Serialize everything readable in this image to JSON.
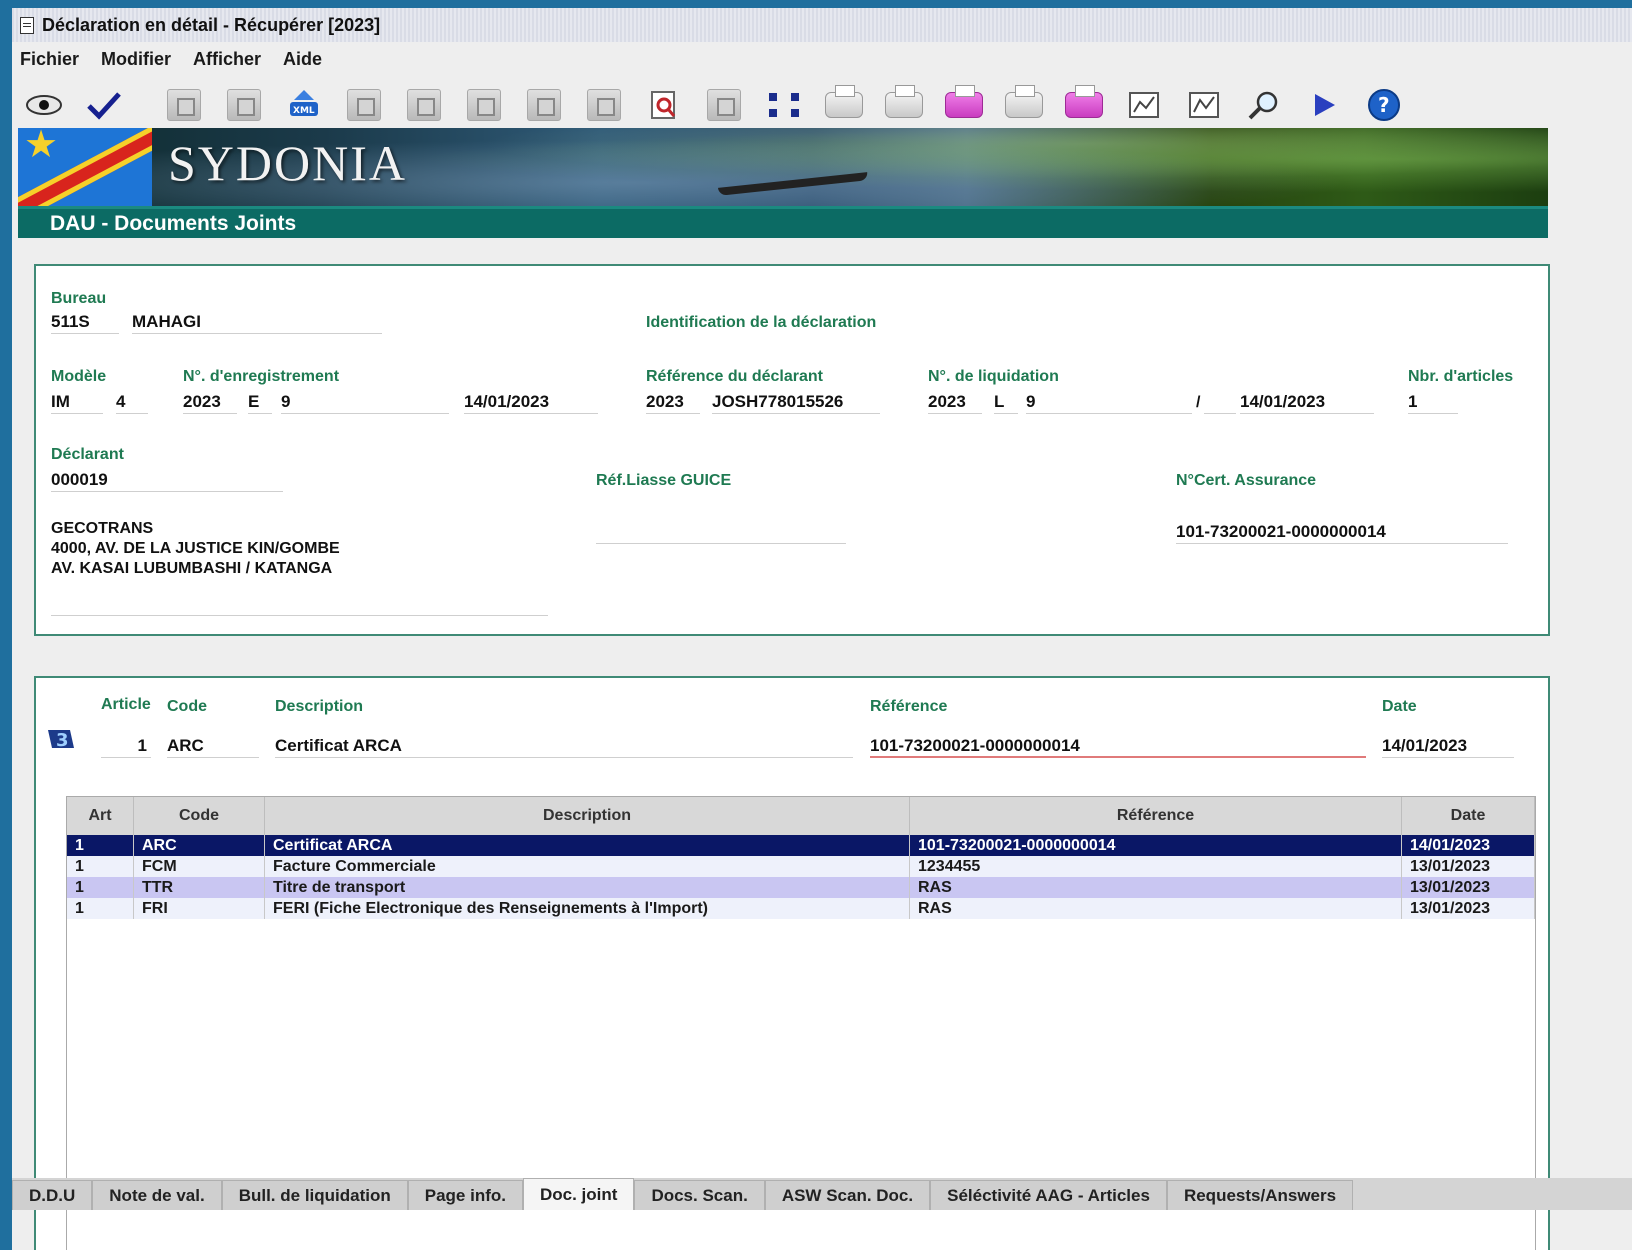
{
  "window": {
    "title": "Déclaration en détail - Récupérer [2023]"
  },
  "menu": [
    "Fichier",
    "Modifier",
    "Afficher",
    "Aide"
  ],
  "banner": {
    "logo": "SYDONIA"
  },
  "section_title": "DAU - Documents Joints",
  "header": {
    "bureau_label": "Bureau",
    "bureau_code": "511S",
    "bureau_name": "MAHAGI",
    "identification_label": "Identification de la déclaration",
    "modele_label": "Modèle",
    "modele_1": "IM",
    "modele_2": "4",
    "enregistrement_label": "N°. d'enregistrement",
    "enr_year": "2023",
    "enr_letter": "E",
    "enr_number": "9",
    "enr_date": "14/01/2023",
    "ref_declarant_label": "Référence du déclarant",
    "ref_year": "2023",
    "ref_number": "JOSH778015526",
    "liquidation_label": "N°. de liquidation",
    "liq_year": "2023",
    "liq_letter": "L",
    "liq_number": "9",
    "liq_slash": "/",
    "liq_date": "14/01/2023",
    "nbr_articles_label": "Nbr. d'articles",
    "nbr_articles": "1",
    "declarant_label": "Déclarant",
    "declarant_code": "000019",
    "ref_liasse_label": "Réf.Liasse GUICE",
    "cert_assurance_label": "N°Cert. Assurance",
    "cert_assurance": "101-73200021-0000000014",
    "declarant_name": "GECOTRANS",
    "declarant_addr1": "4000, AV. DE LA JUSTICE KIN/GOMBE",
    "declarant_addr2": "AV. KASAI LUBUMBASHI / KATANGA"
  },
  "doc_form": {
    "article_label": "Article",
    "code_label": "Code",
    "description_label": "Description",
    "reference_label": "Référence",
    "date_label": "Date",
    "article": "1",
    "code": "ARC",
    "description": "Certificat ARCA",
    "reference": "101-73200021-0000000014",
    "date": "14/01/2023"
  },
  "table": {
    "headers": [
      "Art",
      "Code",
      "Description",
      "Référence",
      "Date"
    ],
    "rows": [
      [
        "1",
        "ARC",
        "Certificat ARCA",
        "101-73200021-0000000014",
        "14/01/2023"
      ],
      [
        "1",
        "FCM",
        "Facture Commerciale",
        "1234455",
        "13/01/2023"
      ],
      [
        "1",
        "TTR",
        "Titre de transport",
        "RAS",
        "13/01/2023"
      ],
      [
        "1",
        "FRI",
        "FERI (Fiche Electronique des Renseignements à l'Import)",
        "RAS",
        "13/01/2023"
      ]
    ]
  },
  "tabs": [
    "D.D.U",
    "Note de val.",
    "Bull. de liquidation",
    "Page info.",
    "Doc. joint",
    "Docs. Scan.",
    "ASW Scan. Doc.",
    "Séléctivité AAG - Articles",
    "Requests/Answers"
  ],
  "active_tab": "Doc. joint"
}
